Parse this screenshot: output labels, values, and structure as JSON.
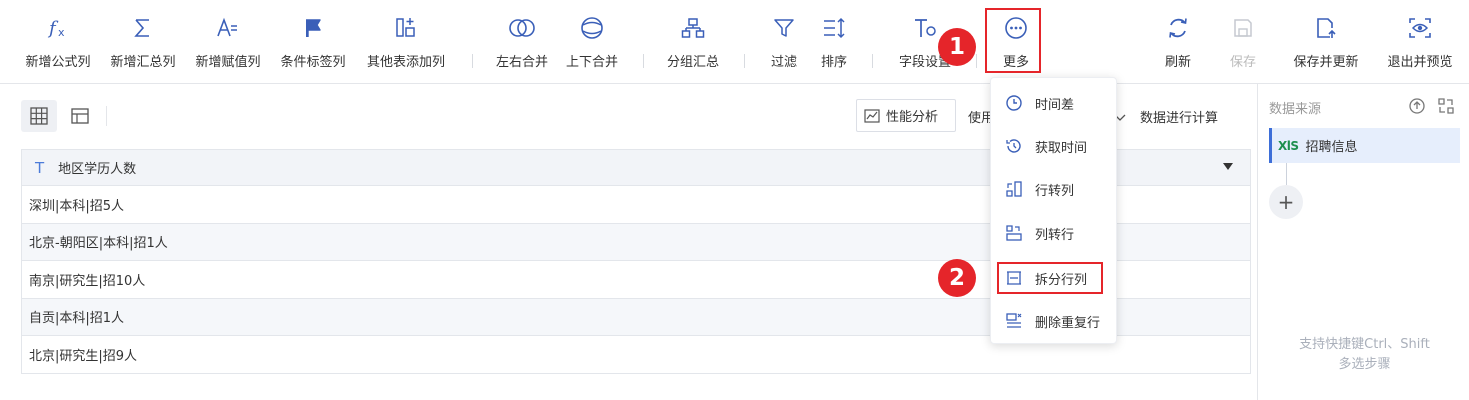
{
  "toolbar": {
    "items": [
      {
        "label": "新增公式列",
        "icon": "formula-icon"
      },
      {
        "label": "新增汇总列",
        "icon": "sigma-icon"
      },
      {
        "label": "新增赋值列",
        "icon": "assign-icon"
      },
      {
        "label": "条件标签列",
        "icon": "flag-icon"
      },
      {
        "label": "其他表添加列",
        "icon": "add-column-icon"
      },
      {
        "label": "左右合并",
        "icon": "merge-horizontal-icon"
      },
      {
        "label": "上下合并",
        "icon": "merge-vertical-icon"
      },
      {
        "label": "分组汇总",
        "icon": "group-icon"
      },
      {
        "label": "过滤",
        "icon": "filter-icon"
      },
      {
        "label": "排序",
        "icon": "sort-icon"
      },
      {
        "label": "字段设置",
        "icon": "field-settings-icon"
      },
      {
        "label": "更多",
        "icon": "more-icon"
      },
      {
        "label": "刷新",
        "icon": "refresh-icon"
      },
      {
        "label": "保存",
        "icon": "save-icon"
      },
      {
        "label": "保存并更新",
        "icon": "save-update-icon"
      },
      {
        "label": "退出并预览",
        "icon": "preview-icon"
      }
    ]
  },
  "annotations": {
    "step1": "1",
    "step2": "2"
  },
  "main": {
    "perf_button": "性能分析",
    "use_label": "使用",
    "calc_label": "数据进行计算"
  },
  "table": {
    "header_type_icon": "T",
    "header": "地区学历人数",
    "rows": [
      "深圳|本科|招5人",
      "北京-朝阳区|本科|招1人",
      "南京|研究生|招10人",
      "自贡|本科|招1人",
      "北京|研究生|招9人"
    ]
  },
  "dropdown": {
    "items": [
      {
        "label": "时间差",
        "icon": "clock-icon"
      },
      {
        "label": "获取时间",
        "icon": "history-icon"
      },
      {
        "label": "行转列",
        "icon": "row-to-column-icon"
      },
      {
        "label": "列转行",
        "icon": "column-to-row-icon"
      },
      {
        "label": "拆分行列",
        "icon": "split-icon"
      },
      {
        "label": "删除重复行",
        "icon": "dedupe-icon"
      }
    ]
  },
  "sidebar": {
    "title": "数据来源",
    "source_badge": "XlS",
    "source_name": "招聘信息",
    "plus": "+",
    "hint_line1": "支持快捷键Ctrl、Shift",
    "hint_line2": "多选步骤"
  },
  "colors": {
    "accent": "#3d6ed8",
    "annotation_red": "#e5252a",
    "icon": "#3a5fb8"
  }
}
